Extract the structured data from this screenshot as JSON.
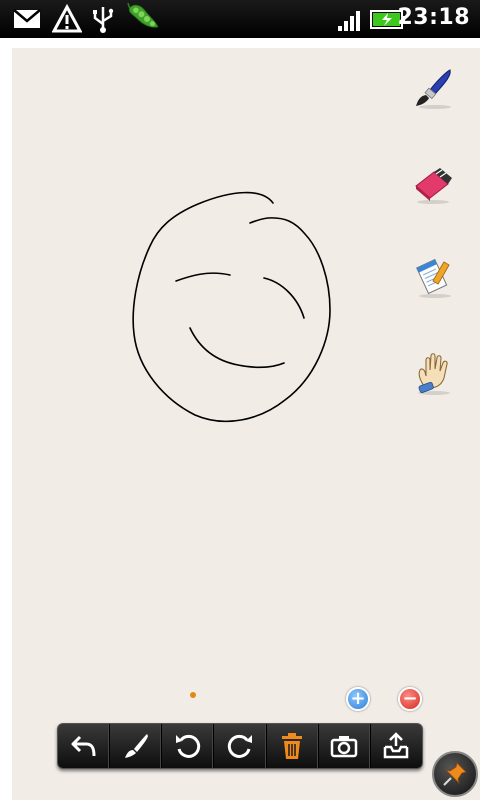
{
  "status_bar": {
    "time": "23:18",
    "icons": [
      "mail-icon",
      "warning-icon",
      "usb-icon",
      "peas-app-icon",
      "signal-icon",
      "battery-charging-icon"
    ]
  },
  "tools": [
    {
      "name": "brush-tool",
      "icon": "paintbrush-icon"
    },
    {
      "name": "eraser-tool",
      "icon": "eraser-icon"
    },
    {
      "name": "notepad-tool",
      "icon": "notepad-icon"
    },
    {
      "name": "hand-tool",
      "icon": "hand-icon"
    }
  ],
  "zoom": {
    "in_label": "+",
    "out_label": "−"
  },
  "toolbar": {
    "items": [
      "undo",
      "brush",
      "rotate-left",
      "rotate-right",
      "delete",
      "camera",
      "export"
    ],
    "accent": "#f08a1c"
  },
  "colors": {
    "canvas": "#f2ece7",
    "stroke": "#000000",
    "page_indicator": "#e08a12"
  }
}
